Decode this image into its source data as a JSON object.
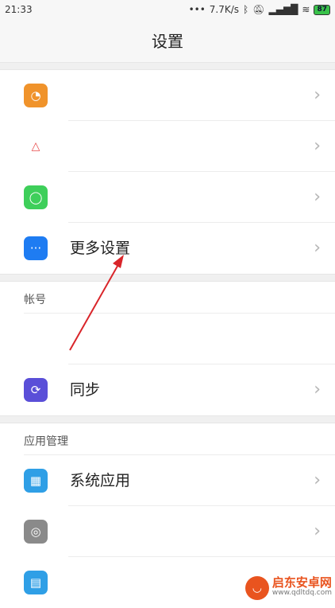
{
  "status_bar": {
    "time": "21:33",
    "net_speed": "7.7K/s",
    "battery": "87",
    "icons": [
      "more-dots-icon",
      "bluetooth-icon",
      "mute-icon",
      "signal-icon",
      "wifi-icon",
      "battery-icon"
    ]
  },
  "header": {
    "title": "设置"
  },
  "rows_top": [
    {
      "label": "",
      "icon": "pie-chart-icon",
      "color": "#f0932b"
    },
    {
      "label": "",
      "icon": "warning-triangle-icon",
      "color": "#e84c4c"
    },
    {
      "label": "",
      "icon": "stopwatch-icon",
      "color": "#3ecf5a"
    },
    {
      "label": "更多设置",
      "icon": "more-dots-icon",
      "color": "#1e7cf2"
    }
  ],
  "section_account": {
    "title": "帐号",
    "sync_label": "同步",
    "sync_color": "#5a4fd8"
  },
  "section_apps": {
    "title": "应用管理",
    "items": [
      {
        "label": "系统应用",
        "icon": "grid-icon",
        "color": "#2f9fe6"
      },
      {
        "label": "",
        "icon": "camera-lens-icon",
        "color": "#8a8a8a"
      },
      {
        "label": "",
        "icon": "document-icon",
        "color": "#2f9fe6"
      }
    ]
  },
  "watermark": {
    "cn": "启东安卓网",
    "en": "www.qdltdq.com"
  }
}
